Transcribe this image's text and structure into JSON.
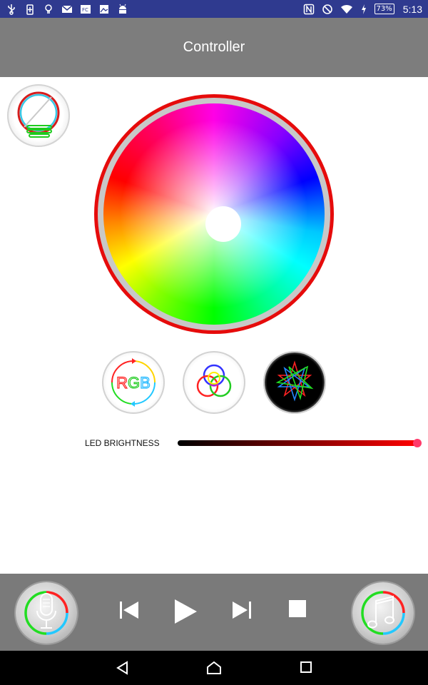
{
  "status_bar": {
    "time": "5:13",
    "battery": "73%",
    "left_icons": [
      "usb-icon",
      "battery-saver-icon",
      "bulb-notif-icon",
      "gmail-icon",
      "fc-icon",
      "photos-icon",
      "android-icon"
    ],
    "right_icons": [
      "nfc-icon",
      "do-not-disturb-icon",
      "wifi-icon",
      "charging-icon"
    ]
  },
  "app_bar": {
    "title": "Controller"
  },
  "color_wheel": {
    "ring_color": "#e60b0b"
  },
  "modes": {
    "rgb_label": "RGB",
    "selected": "star"
  },
  "brightness": {
    "label": "LED BRIGHTNESS",
    "value_fraction": 1.0,
    "thumb_color": "#ff3a6a"
  },
  "player": {
    "controls": [
      "skip-previous-icon",
      "play-icon",
      "skip-next-icon",
      "stop-icon"
    ]
  },
  "navigation": [
    "back-icon",
    "home-icon",
    "recents-icon"
  ]
}
